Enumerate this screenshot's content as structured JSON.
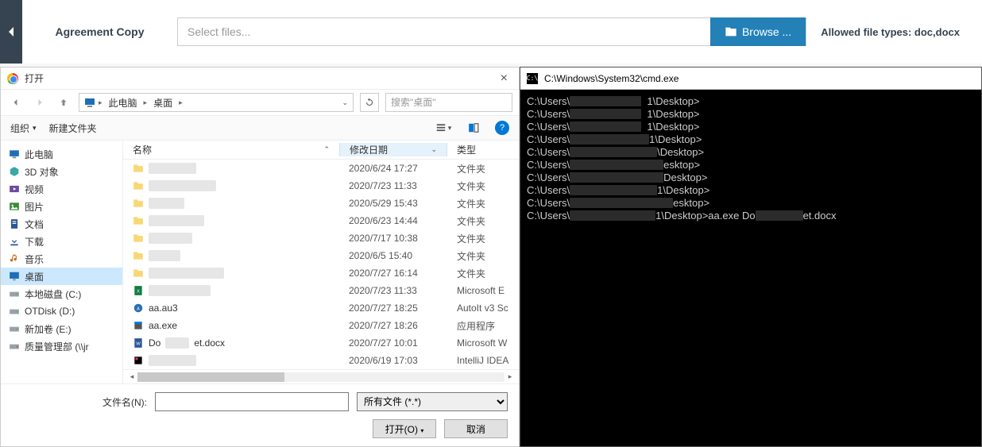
{
  "upload": {
    "label": "Agreement Copy",
    "placeholder": "Select files...",
    "browse_label": "Browse ...",
    "allowed_label": "Allowed file types: doc,docx"
  },
  "dialog": {
    "title": "打开",
    "breadcrumb": {
      "root": "此电脑",
      "folder": "桌面"
    },
    "search_placeholder": "搜索\"桌面\"",
    "toolbar": {
      "organize": "组织",
      "new_folder": "新建文件夹"
    },
    "tree": [
      {
        "label": "此电脑",
        "icon": "pc"
      },
      {
        "label": "3D 对象",
        "icon": "3d"
      },
      {
        "label": "视频",
        "icon": "video"
      },
      {
        "label": "图片",
        "icon": "image"
      },
      {
        "label": "文档",
        "icon": "doc"
      },
      {
        "label": "下载",
        "icon": "download"
      },
      {
        "label": "音乐",
        "icon": "music"
      },
      {
        "label": "桌面",
        "icon": "desktop",
        "selected": true
      },
      {
        "label": "本地磁盘 (C:)",
        "icon": "drive"
      },
      {
        "label": "OTDisk (D:)",
        "icon": "drive"
      },
      {
        "label": "新加卷 (E:)",
        "icon": "drive"
      },
      {
        "label": "质量管理部 (\\\\jr",
        "icon": "netdrive"
      }
    ],
    "headers": {
      "name": "名称",
      "date": "修改日期",
      "type": "类型"
    },
    "rows": [
      {
        "name": "",
        "date": "2020/6/24 17:27",
        "type": "文件夹",
        "icon": "folder",
        "redacted": true,
        "rw": 60
      },
      {
        "name": "",
        "date": "2020/7/23 11:33",
        "type": "文件夹",
        "icon": "folder",
        "redacted": true,
        "rw": 85
      },
      {
        "name": "",
        "date": "2020/5/29 15:43",
        "type": "文件夹",
        "icon": "folder",
        "redacted": true,
        "rw": 45
      },
      {
        "name": "",
        "date": "2020/6/23 14:44",
        "type": "文件夹",
        "icon": "folder",
        "redacted": true,
        "rw": 70
      },
      {
        "name": "",
        "date": "2020/7/17 10:38",
        "type": "文件夹",
        "icon": "folder",
        "redacted": true,
        "rw": 55
      },
      {
        "name": "",
        "date": "2020/6/5 15:40",
        "type": "文件夹",
        "icon": "folder",
        "redacted": true,
        "rw": 40
      },
      {
        "name": "",
        "date": "2020/7/27 16:14",
        "type": "文件夹",
        "icon": "folder",
        "redacted": true,
        "rw": 95
      },
      {
        "name": "",
        "date": "2020/7/23 11:33",
        "type": "Microsoft E",
        "icon": "excel",
        "redacted": true,
        "rw": 78
      },
      {
        "name": "aa.au3",
        "date": "2020/7/27 18:25",
        "type": "AutoIt v3 Sc",
        "icon": "au3"
      },
      {
        "name": "aa.exe",
        "date": "2020/7/27 18:26",
        "type": "应用程序",
        "icon": "exe"
      },
      {
        "name": "Do",
        "suffix": "et.docx",
        "date": "2020/7/27 10:01",
        "type": "Microsoft W",
        "icon": "word",
        "partial_redacted": true,
        "rw": 30
      },
      {
        "name": "",
        "date": "2020/6/19 17:03",
        "type": "IntelliJ IDEA",
        "icon": "idea",
        "redacted": true,
        "rw": 60
      }
    ],
    "filename_label": "文件名(N):",
    "filter_label": "所有文件 (*.*)",
    "open_label": "打开(O)",
    "cancel_label": "取消"
  },
  "cmd": {
    "title": "C:\\Windows\\System32\\cmd.exe",
    "lines": [
      {
        "prefix": "C:\\Users\\",
        "rw": 90,
        "suffix": "  1\\Desktop>"
      },
      {
        "prefix": "C:\\Users\\",
        "rw": 90,
        "suffix": "  1\\Desktop>"
      },
      {
        "prefix": "C:\\Users\\",
        "rw": 90,
        "suffix": "  1\\Desktop>"
      },
      {
        "prefix": "C:\\Users\\",
        "rw": 100,
        "suffix": "1\\Desktop>"
      },
      {
        "prefix": "C:\\Users\\",
        "rw": 110,
        "suffix": "\\Desktop>"
      },
      {
        "prefix": "C:\\Users\\",
        "rw": 118,
        "suffix": "esktop>"
      },
      {
        "prefix": "C:\\Users\\",
        "rw": 118,
        "suffix": "Desktop>"
      },
      {
        "prefix": "C:\\Users\\",
        "rw": 110,
        "suffix": "1\\Desktop>"
      },
      {
        "prefix": "C:\\Users\\",
        "rw": 130,
        "suffix": "esktop>"
      },
      {
        "prefix": "C:\\Users\\",
        "rw": 108,
        "suffix": "1\\Desktop>aa.exe Do",
        "tail_rw": 60,
        "tail": "et.docx"
      }
    ]
  }
}
